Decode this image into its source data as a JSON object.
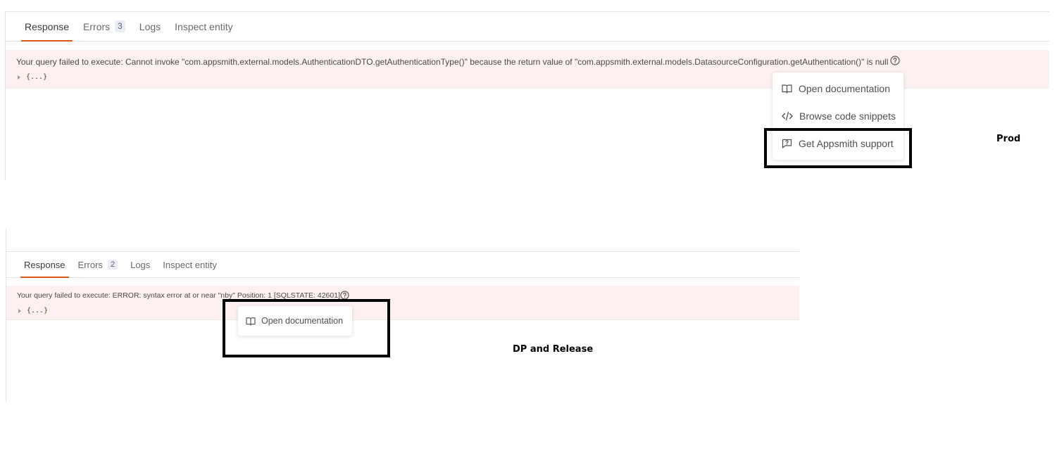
{
  "prod": {
    "tabs": [
      {
        "label": "Response",
        "active": true
      },
      {
        "label": "Errors",
        "badge": "3"
      },
      {
        "label": "Logs"
      },
      {
        "label": "Inspect entity"
      }
    ],
    "error_message": "Your query failed to execute: Cannot invoke \"com.appsmith.external.models.AuthenticationDTO.getAuthenticationType()\" because the return value of \"com.appsmith.external.models.DatasourceConfiguration.getAuthentication()\" is null",
    "json_collapsed": "{...}",
    "menu": {
      "items": [
        {
          "label": "Open documentation",
          "icon": "book-icon"
        },
        {
          "label": "Browse code snippets",
          "icon": "code-icon"
        },
        {
          "label": "Get Appsmith support",
          "icon": "support-icon"
        }
      ]
    },
    "env_label": "Prod"
  },
  "dp": {
    "tabs": [
      {
        "label": "Response",
        "active": true
      },
      {
        "label": "Errors",
        "badge": "2"
      },
      {
        "label": "Logs"
      },
      {
        "label": "Inspect entity"
      }
    ],
    "error_message": "Your query failed to execute: ERROR: syntax error at or near \"nby\" Position: 1 [SQLSTATE: 42601]",
    "json_collapsed": "{...}",
    "menu": {
      "items": [
        {
          "label": "Open documentation",
          "icon": "book-icon"
        }
      ]
    },
    "env_label": "DP and Release"
  },
  "colors": {
    "accent": "#e15615",
    "error_bg": "#fdf0f0",
    "highlight": "#000000"
  }
}
